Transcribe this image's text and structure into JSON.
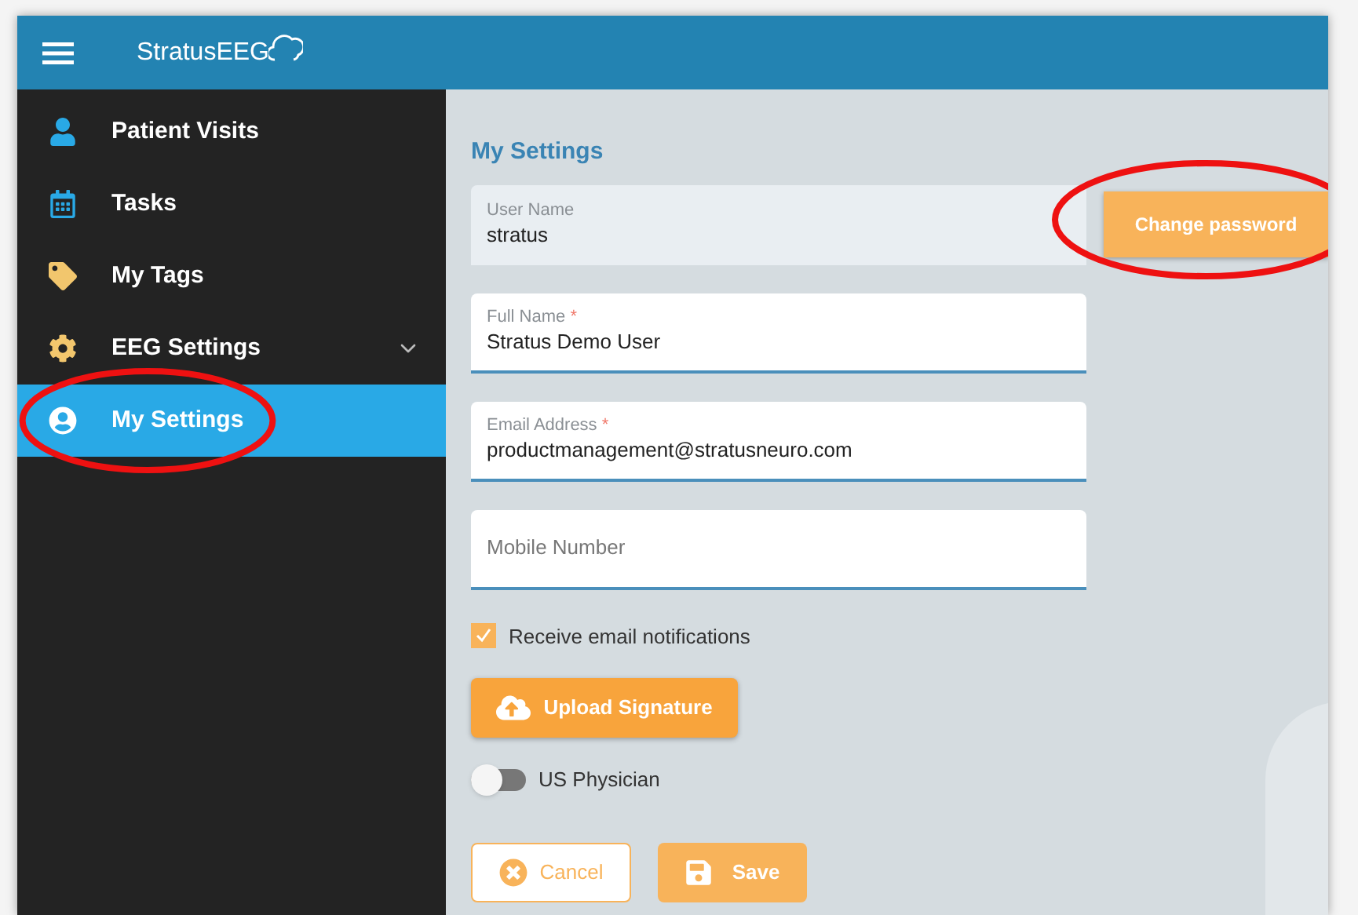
{
  "header": {
    "logo": "StratusEEG"
  },
  "sidebar": {
    "items": [
      {
        "label": "Patient Visits",
        "selected": false,
        "expandable": false,
        "circled": false
      },
      {
        "label": "Tasks",
        "selected": false,
        "expandable": false,
        "circled": false
      },
      {
        "label": "My Tags",
        "selected": false,
        "expandable": false,
        "circled": false
      },
      {
        "label": "EEG Settings",
        "selected": false,
        "expandable": true,
        "circled": false
      },
      {
        "label": "My Settings",
        "selected": true,
        "expandable": false,
        "circled": true
      }
    ]
  },
  "main": {
    "title": "My Settings",
    "fields": [
      {
        "label": "User Name",
        "value": "stratus",
        "disabled": true
      },
      {
        "label": "Full Name",
        "required_mark": "*",
        "value": "Stratus Demo User",
        "disabled": false
      },
      {
        "label": "Email Address",
        "required_mark": "*",
        "value": "productmanagement@stratusneuro.com",
        "disabled": false
      },
      {
        "placeholder": "Mobile Number",
        "disabled": false
      }
    ],
    "change_password": {
      "label": "Change password",
      "circled": true
    },
    "email_notifications": {
      "label": "Receive email notifications",
      "checked": true
    },
    "upload_button": "Upload Signature",
    "us_physician": {
      "label": "US Physician",
      "on": false
    },
    "buttons": [
      {
        "kind": "cancel",
        "label": "Cancel"
      },
      {
        "kind": "save",
        "label": "Save"
      }
    ]
  }
}
